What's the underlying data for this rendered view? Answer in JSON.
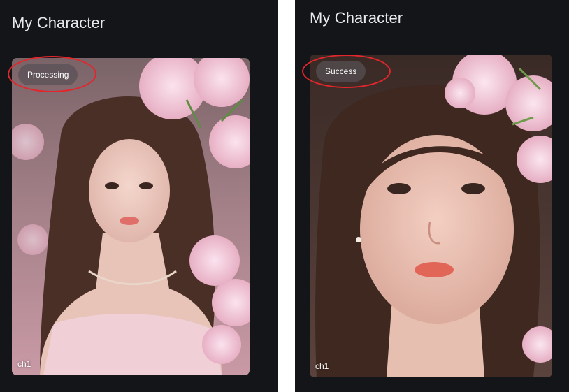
{
  "panels": [
    {
      "title": "My Character",
      "card": {
        "status": "Processing",
        "name": "ch1"
      }
    },
    {
      "title": "My Character",
      "card": {
        "status": "Success",
        "name": "ch1"
      }
    }
  ],
  "colors": {
    "background": "#141518",
    "title_text": "#e8e9ec",
    "badge_background": "#585056",
    "annotation_ring": "#e2262b"
  }
}
